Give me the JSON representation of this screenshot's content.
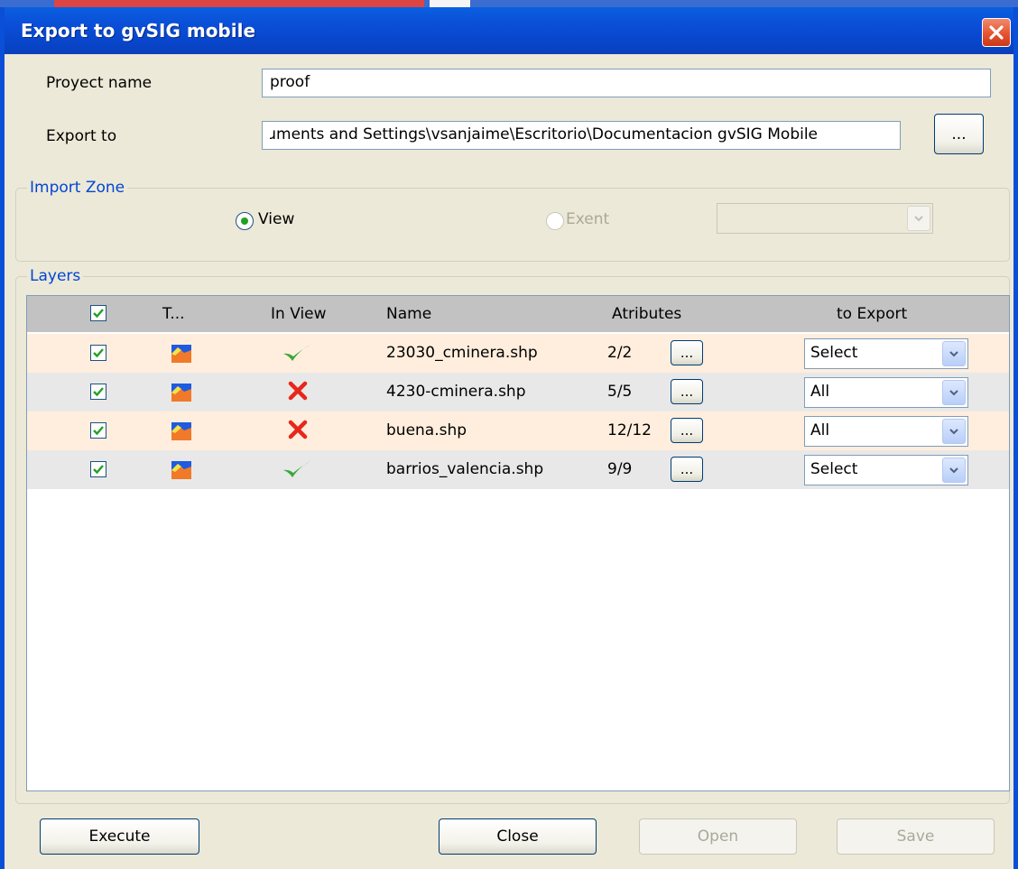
{
  "window": {
    "title": "Export to gvSIG mobile"
  },
  "project": {
    "label": "Proyect name",
    "value": "proof"
  },
  "export_to": {
    "label": "Export to",
    "value": "ɹments and Settings\\vsanjaime\\Escritorio\\Documentacion gvSIG Mobile",
    "browse_label": "..."
  },
  "import_zone": {
    "title": "Import Zone",
    "view_label": "View",
    "view_selected": true,
    "extent_label": "Exent",
    "extent_selected": false,
    "extent_value": ""
  },
  "layers": {
    "title": "Layers",
    "columns": {
      "check": "",
      "type": "T...",
      "in_view": "In View",
      "name": "Name",
      "attributes": "Atributes",
      "to_export": "to Export"
    },
    "rows": [
      {
        "checked": true,
        "in_view": "check",
        "name": "23030_cminera.shp",
        "attributes": "2/2",
        "attr_button": "...",
        "export": "Select"
      },
      {
        "checked": true,
        "in_view": "cross",
        "name": "4230-cminera.shp",
        "attributes": "5/5",
        "attr_button": "...",
        "export": "All"
      },
      {
        "checked": true,
        "in_view": "cross",
        "name": "buena.shp",
        "attributes": "12/12",
        "attr_button": "...",
        "export": "All"
      },
      {
        "checked": true,
        "in_view": "check",
        "name": "barrios_valencia.shp",
        "attributes": "9/9",
        "attr_button": "...",
        "export": "Select"
      }
    ]
  },
  "buttons": {
    "execute": "Execute",
    "close": "Close",
    "open": "Open",
    "save": "Save"
  },
  "colors": {
    "titlebar": "#0a4fd8",
    "accent": "#0046d5",
    "row_odd": "#ffeedd",
    "row_even": "#e8e8e8",
    "ok_green": "#3aa83a",
    "cross_red": "#e8261c"
  }
}
